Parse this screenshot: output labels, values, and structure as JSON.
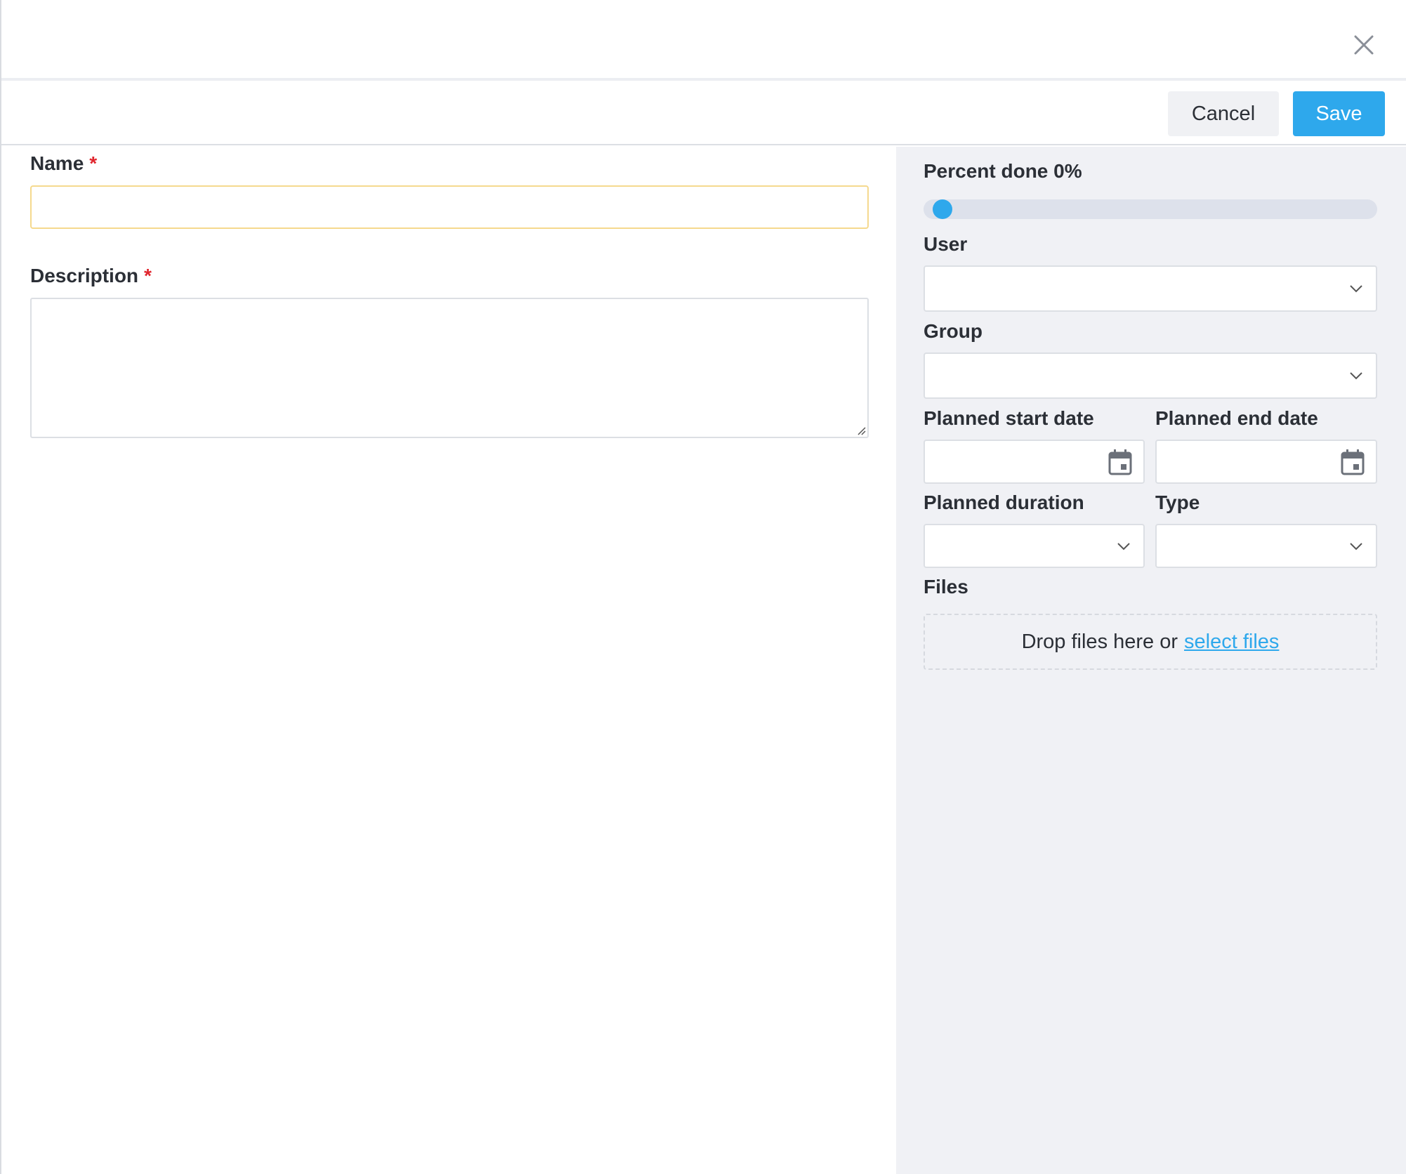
{
  "header": {
    "close_icon": "close-icon"
  },
  "toolbar": {
    "cancel_label": "Cancel",
    "save_label": "Save",
    "accent": "#2ea8ec"
  },
  "form": {
    "name_label": "Name",
    "name_required": "*",
    "name_value": "",
    "description_label": "Description",
    "description_required": "*",
    "description_value": ""
  },
  "side": {
    "percent_label": "Percent done 0%",
    "percent_value": 0,
    "user_label": "User",
    "user_value": "",
    "group_label": "Group",
    "group_value": "",
    "start_label": "Planned start date",
    "start_value": "",
    "end_label": "Planned end date",
    "end_value": "",
    "duration_label": "Planned duration",
    "duration_value": "",
    "type_label": "Type",
    "type_value": "",
    "files_label": "Files",
    "drop_text": "Drop files here or",
    "select_link": "select files"
  }
}
